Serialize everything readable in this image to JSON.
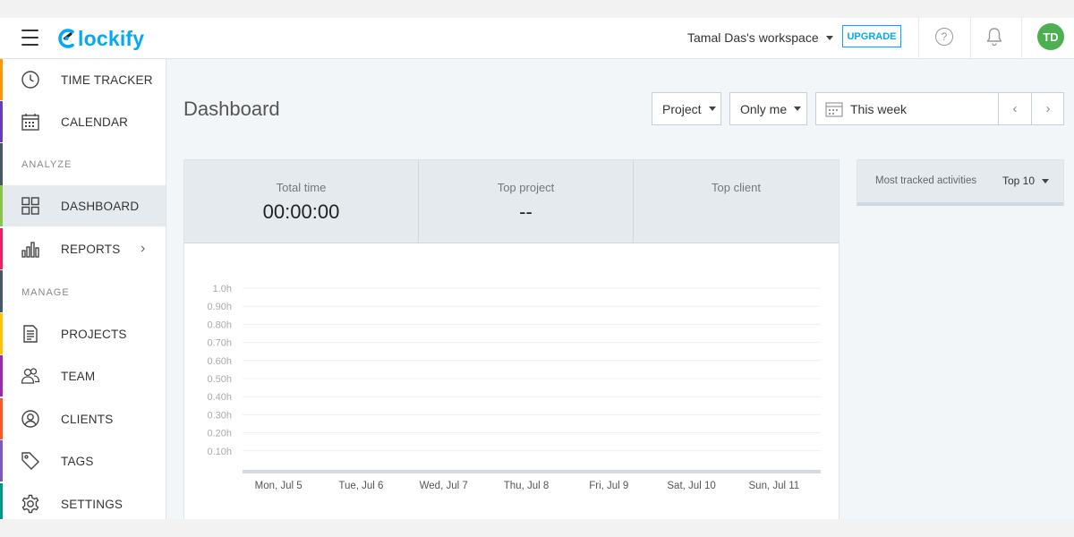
{
  "app": {
    "logo_text": "lockify",
    "brand_color": "#03a9f4"
  },
  "header": {
    "workspace": "Tamal Das's workspace",
    "upgrade_label": "UPGRADE",
    "help_glyph": "?",
    "avatar_initials": "TD",
    "avatar_color": "#4caf50"
  },
  "sidebar": {
    "sections": {
      "analyze": "ANALYZE",
      "manage": "MANAGE"
    },
    "items": [
      {
        "label": "TIME TRACKER",
        "icon": "clock-icon",
        "color": "#ff9800"
      },
      {
        "label": "CALENDAR",
        "icon": "calendar-icon",
        "color": "#673ab7"
      },
      {
        "label": "DASHBOARD",
        "icon": "dashboard-grid-icon",
        "color": "#8bc34a",
        "active": true
      },
      {
        "label": "REPORTS",
        "icon": "bar-chart-icon",
        "color": "#e91e63"
      },
      {
        "label": "PROJECTS",
        "icon": "document-icon",
        "color": "#ffc107"
      },
      {
        "label": "TEAM",
        "icon": "team-icon",
        "color": "#9c27b0"
      },
      {
        "label": "CLIENTS",
        "icon": "client-icon",
        "color": "#ff5722"
      },
      {
        "label": "TAGS",
        "icon": "tag-icon",
        "color": "#7e57c2"
      },
      {
        "label": "SETTINGS",
        "icon": "gear-icon",
        "color": "#009688"
      }
    ]
  },
  "main": {
    "title": "Dashboard",
    "filters": {
      "group_by": "Project",
      "scope": "Only me",
      "date_range": "This week"
    },
    "stats": [
      {
        "label": "Total time",
        "value": "00:00:00"
      },
      {
        "label": "Top project",
        "value": "--"
      },
      {
        "label": "Top client",
        "value": ""
      }
    ],
    "side_card": {
      "label": "Most tracked activities",
      "top_n": "Top 10"
    }
  },
  "chart_data": {
    "type": "bar",
    "categories": [
      "Mon, Jul 5",
      "Tue, Jul 6",
      "Wed, Jul 7",
      "Thu, Jul 8",
      "Fri, Jul 9",
      "Sat, Jul 10",
      "Sun, Jul 11"
    ],
    "values": [
      0,
      0,
      0,
      0,
      0,
      0,
      0
    ],
    "y_ticks": [
      "0.10h",
      "0.20h",
      "0.30h",
      "0.40h",
      "0.50h",
      "0.60h",
      "0.70h",
      "0.80h",
      "0.90h",
      "1.0h"
    ],
    "ylim": [
      0,
      1.0
    ],
    "grid": true
  }
}
